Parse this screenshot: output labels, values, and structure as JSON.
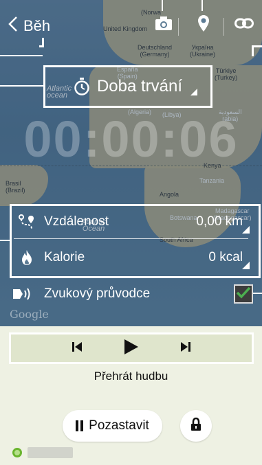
{
  "header": {
    "back_label": "Běh"
  },
  "map": {
    "labels": [
      "(Norwa",
      "United Kingdom",
      "Deutschland\n(Germany)",
      "Україна\n(Ukraine)",
      "España\n(Spain)",
      "Türkiye\n(Turkey)",
      "Atlantic\nocean",
      "(Algeria)",
      "(Libya)",
      "السعودية\nrabia)",
      "Kenya",
      "Tanzania",
      "Brasil\n(Brazil)",
      "Angola",
      "Botswana",
      "Madagascar\n(Madagascar)",
      "South Africa",
      "Atlantic\nOcean",
      "Google"
    ]
  },
  "duration": {
    "label": "Doba trvání"
  },
  "timer": {
    "value": "00:00:06"
  },
  "stats": {
    "distance_label": "Vzdálenost",
    "distance_value": "0,00 km",
    "calories_label": "Kalorie",
    "calories_value": "0 kcal"
  },
  "voice_guide": {
    "label": "Zvukový průvodce",
    "checked": true
  },
  "music": {
    "play_label": "Přehrát hudbu"
  },
  "actions": {
    "pause_label": "Pozastavit"
  },
  "icons": {
    "back": "chevron-left-icon",
    "camera": "camera-icon",
    "location": "map-pin-icon",
    "link": "link-icon",
    "stopwatch": "stopwatch-icon",
    "distance": "route-icon",
    "calories": "flame-icon",
    "voice": "speaker-icon",
    "prev": "skip-previous-icon",
    "play": "play-icon",
    "next": "skip-next-icon",
    "lock": "lock-icon",
    "gps": "gps-icon"
  },
  "colors": {
    "accent_check": "#4caf50",
    "callout": "#ffffff",
    "panel": "#eef1e3",
    "controls_bg": "#dfe5cc"
  }
}
